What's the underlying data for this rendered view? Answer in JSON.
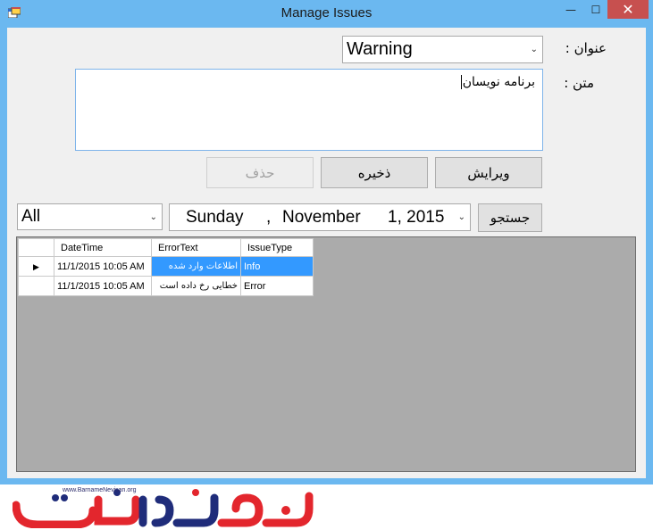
{
  "window": {
    "title": "Manage Issues",
    "minimize_glyph": "—",
    "maximize_glyph": "☐",
    "close_glyph": "✕"
  },
  "form": {
    "title_label": "عنوان :",
    "title_value": "Warning",
    "text_label": "متن :",
    "text_value": "برنامه نویسان"
  },
  "buttons": {
    "delete": "حذف",
    "save": "ذخیره",
    "edit": "ویرایش",
    "search": "جستجو"
  },
  "filter": {
    "type_value": "All",
    "date_weekday": "Sunday",
    "date_sep": ",",
    "date_month": "November",
    "date_day_year": "1, 2015"
  },
  "grid": {
    "columns": [
      "DateTime",
      "ErrorText",
      "IssueType"
    ],
    "rows": [
      {
        "datetime": "11/1/2015 10:05 AM",
        "error_text": "اطلاعات وارد شده",
        "issue_type": "Info",
        "selected": true
      },
      {
        "datetime": "11/1/2015 10:05 AM",
        "error_text": "خطایی رخ داده است",
        "issue_type": "Error",
        "selected": false
      }
    ]
  },
  "footer": {
    "logo_url": "www.BarnameNevisan.org"
  },
  "colors": {
    "titlebar": "#6bb8f0",
    "close": "#c7504f",
    "selection": "#3399ff",
    "grid_bg": "#ababab",
    "logo_red": "#e3262d",
    "logo_blue": "#1f2c7a"
  }
}
